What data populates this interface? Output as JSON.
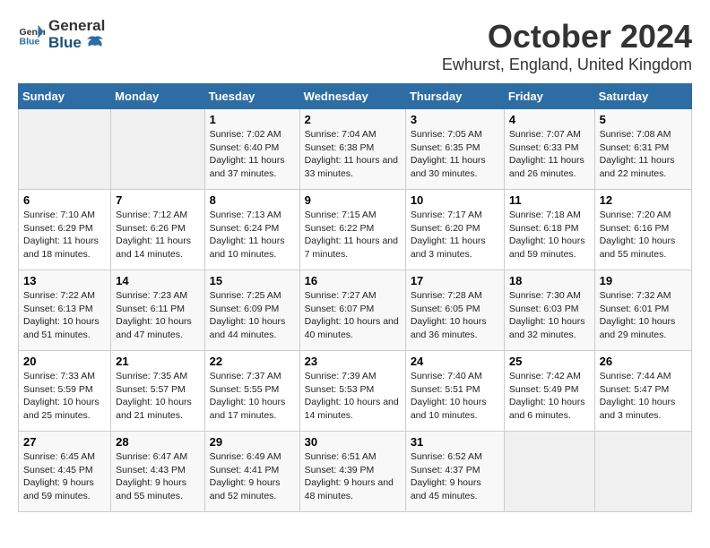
{
  "logo": {
    "general": "General",
    "blue": "Blue"
  },
  "header": {
    "month": "October 2024",
    "location": "Ewhurst, England, United Kingdom"
  },
  "weekdays": [
    "Sunday",
    "Monday",
    "Tuesday",
    "Wednesday",
    "Thursday",
    "Friday",
    "Saturday"
  ],
  "weeks": [
    [
      {
        "day": "",
        "info": ""
      },
      {
        "day": "",
        "info": ""
      },
      {
        "day": "1",
        "info": "Sunrise: 7:02 AM\nSunset: 6:40 PM\nDaylight: 11 hours and 37 minutes."
      },
      {
        "day": "2",
        "info": "Sunrise: 7:04 AM\nSunset: 6:38 PM\nDaylight: 11 hours and 33 minutes."
      },
      {
        "day": "3",
        "info": "Sunrise: 7:05 AM\nSunset: 6:35 PM\nDaylight: 11 hours and 30 minutes."
      },
      {
        "day": "4",
        "info": "Sunrise: 7:07 AM\nSunset: 6:33 PM\nDaylight: 11 hours and 26 minutes."
      },
      {
        "day": "5",
        "info": "Sunrise: 7:08 AM\nSunset: 6:31 PM\nDaylight: 11 hours and 22 minutes."
      }
    ],
    [
      {
        "day": "6",
        "info": "Sunrise: 7:10 AM\nSunset: 6:29 PM\nDaylight: 11 hours and 18 minutes."
      },
      {
        "day": "7",
        "info": "Sunrise: 7:12 AM\nSunset: 6:26 PM\nDaylight: 11 hours and 14 minutes."
      },
      {
        "day": "8",
        "info": "Sunrise: 7:13 AM\nSunset: 6:24 PM\nDaylight: 11 hours and 10 minutes."
      },
      {
        "day": "9",
        "info": "Sunrise: 7:15 AM\nSunset: 6:22 PM\nDaylight: 11 hours and 7 minutes."
      },
      {
        "day": "10",
        "info": "Sunrise: 7:17 AM\nSunset: 6:20 PM\nDaylight: 11 hours and 3 minutes."
      },
      {
        "day": "11",
        "info": "Sunrise: 7:18 AM\nSunset: 6:18 PM\nDaylight: 10 hours and 59 minutes."
      },
      {
        "day": "12",
        "info": "Sunrise: 7:20 AM\nSunset: 6:16 PM\nDaylight: 10 hours and 55 minutes."
      }
    ],
    [
      {
        "day": "13",
        "info": "Sunrise: 7:22 AM\nSunset: 6:13 PM\nDaylight: 10 hours and 51 minutes."
      },
      {
        "day": "14",
        "info": "Sunrise: 7:23 AM\nSunset: 6:11 PM\nDaylight: 10 hours and 47 minutes."
      },
      {
        "day": "15",
        "info": "Sunrise: 7:25 AM\nSunset: 6:09 PM\nDaylight: 10 hours and 44 minutes."
      },
      {
        "day": "16",
        "info": "Sunrise: 7:27 AM\nSunset: 6:07 PM\nDaylight: 10 hours and 40 minutes."
      },
      {
        "day": "17",
        "info": "Sunrise: 7:28 AM\nSunset: 6:05 PM\nDaylight: 10 hours and 36 minutes."
      },
      {
        "day": "18",
        "info": "Sunrise: 7:30 AM\nSunset: 6:03 PM\nDaylight: 10 hours and 32 minutes."
      },
      {
        "day": "19",
        "info": "Sunrise: 7:32 AM\nSunset: 6:01 PM\nDaylight: 10 hours and 29 minutes."
      }
    ],
    [
      {
        "day": "20",
        "info": "Sunrise: 7:33 AM\nSunset: 5:59 PM\nDaylight: 10 hours and 25 minutes."
      },
      {
        "day": "21",
        "info": "Sunrise: 7:35 AM\nSunset: 5:57 PM\nDaylight: 10 hours and 21 minutes."
      },
      {
        "day": "22",
        "info": "Sunrise: 7:37 AM\nSunset: 5:55 PM\nDaylight: 10 hours and 17 minutes."
      },
      {
        "day": "23",
        "info": "Sunrise: 7:39 AM\nSunset: 5:53 PM\nDaylight: 10 hours and 14 minutes."
      },
      {
        "day": "24",
        "info": "Sunrise: 7:40 AM\nSunset: 5:51 PM\nDaylight: 10 hours and 10 minutes."
      },
      {
        "day": "25",
        "info": "Sunrise: 7:42 AM\nSunset: 5:49 PM\nDaylight: 10 hours and 6 minutes."
      },
      {
        "day": "26",
        "info": "Sunrise: 7:44 AM\nSunset: 5:47 PM\nDaylight: 10 hours and 3 minutes."
      }
    ],
    [
      {
        "day": "27",
        "info": "Sunrise: 6:45 AM\nSunset: 4:45 PM\nDaylight: 9 hours and 59 minutes."
      },
      {
        "day": "28",
        "info": "Sunrise: 6:47 AM\nSunset: 4:43 PM\nDaylight: 9 hours and 55 minutes."
      },
      {
        "day": "29",
        "info": "Sunrise: 6:49 AM\nSunset: 4:41 PM\nDaylight: 9 hours and 52 minutes."
      },
      {
        "day": "30",
        "info": "Sunrise: 6:51 AM\nSunset: 4:39 PM\nDaylight: 9 hours and 48 minutes."
      },
      {
        "day": "31",
        "info": "Sunrise: 6:52 AM\nSunset: 4:37 PM\nDaylight: 9 hours and 45 minutes."
      },
      {
        "day": "",
        "info": ""
      },
      {
        "day": "",
        "info": ""
      }
    ]
  ]
}
